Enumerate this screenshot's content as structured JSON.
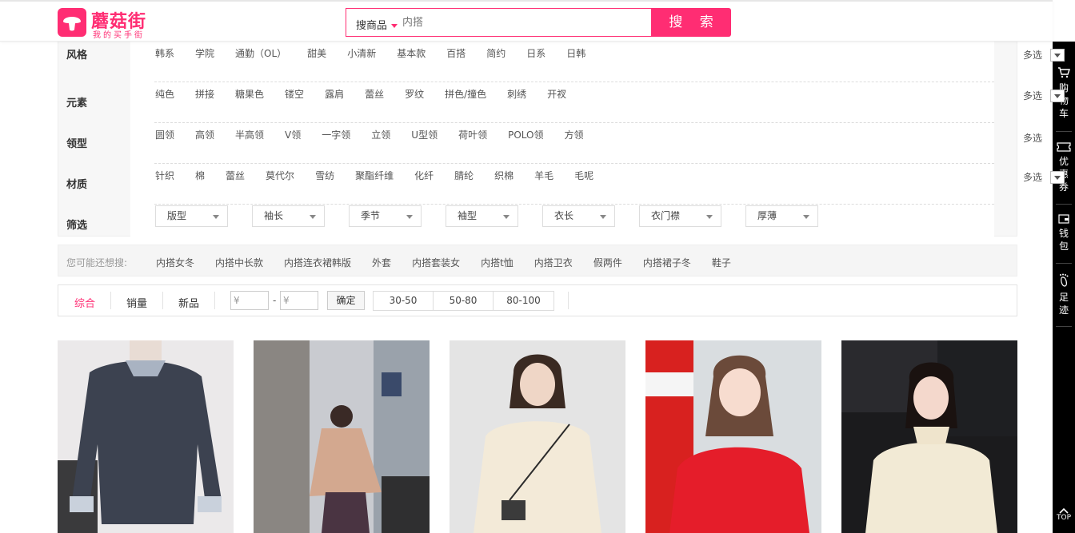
{
  "header": {
    "logo_name": "蘑菇街",
    "logo_sub": "我的买手街",
    "search_type": "搜商品",
    "search_placeholder": "内搭",
    "search_button": "搜 索"
  },
  "filters": [
    {
      "label": "风格",
      "items": [
        "韩系",
        "学院",
        "通勤（OL）",
        "甜美",
        "小清新",
        "基本款",
        "百搭",
        "简约",
        "日系",
        "日韩"
      ],
      "multi": "多选",
      "has_toggle": true
    },
    {
      "label": "元素",
      "items": [
        "纯色",
        "拼接",
        "糖果色",
        "镂空",
        "露肩",
        "蕾丝",
        "罗纹",
        "拼色/撞色",
        "刺绣",
        "开衩"
      ],
      "multi": "多选",
      "has_toggle": true
    },
    {
      "label": "领型",
      "items": [
        "圆领",
        "高领",
        "半高领",
        "V领",
        "一字领",
        "立领",
        "U型领",
        "荷叶领",
        "POLO领",
        "方领"
      ],
      "multi": "多选",
      "has_toggle": false
    },
    {
      "label": "材质",
      "items": [
        "针织",
        "棉",
        "蕾丝",
        "莫代尔",
        "雪纺",
        "聚酯纤维",
        "化纤",
        "腈纶",
        "织棉",
        "羊毛",
        "毛呢"
      ],
      "multi": "多选",
      "has_toggle": true
    }
  ],
  "screen": {
    "label": "筛选",
    "dropdowns": [
      "版型",
      "袖长",
      "季节",
      "袖型",
      "衣长",
      "衣门襟",
      "厚薄"
    ]
  },
  "suggest": {
    "label": "您可能还想搜:",
    "items": [
      "内搭女冬",
      "内搭中长款",
      "内搭连衣裙韩版",
      "外套",
      "内搭套装女",
      "内搭t恤",
      "内搭卫衣",
      "假两件",
      "内搭裙子冬",
      "鞋子"
    ]
  },
  "sort": {
    "tabs": [
      "综合",
      "销量",
      "新品"
    ],
    "active": "综合",
    "price_min_placeholder": "¥",
    "price_max_placeholder": "¥",
    "dash": "-",
    "confirm": "确定",
    "ranges": [
      "30-50",
      "50-80",
      "80-100"
    ]
  },
  "right_bar": {
    "items": [
      "购物车",
      "优惠券",
      "钱包",
      "足迹"
    ],
    "top": "TOP"
  },
  "colors": {
    "brand": "#ff2d73",
    "bar": "#000000",
    "panel_bg": "#f7f7f7"
  },
  "products": [
    {
      "image": "woman in dark grey knit sweater over striped shirt"
    },
    {
      "image": "woman in camel cape on city street"
    },
    {
      "image": "woman in cream sweater with crossbody bag"
    },
    {
      "image": "woman in red sweater"
    },
    {
      "image": "woman in cream ruffle-neck knit"
    }
  ]
}
